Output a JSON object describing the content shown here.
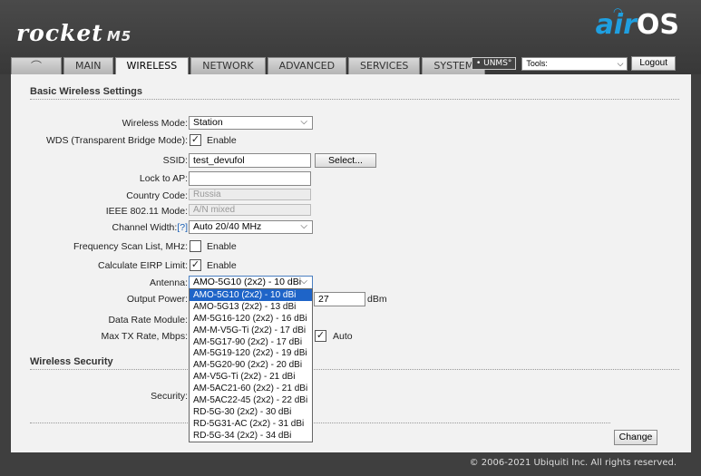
{
  "header": {
    "logo_product": "rocket",
    "logo_model": "M5",
    "logo_airos_air": "air",
    "logo_airos_os": "OS"
  },
  "tabs": [
    {
      "label": "MAIN"
    },
    {
      "label": "WIRELESS",
      "active": true
    },
    {
      "label": "NETWORK"
    },
    {
      "label": "ADVANCED"
    },
    {
      "label": "SERVICES"
    },
    {
      "label": "SYSTEM"
    }
  ],
  "logo_tab_glyph": "⌒",
  "topbar": {
    "unms_label": "• UNMS°",
    "tools_value": "Tools:",
    "logout_label": "Logout"
  },
  "basic": {
    "title": "Basic Wireless Settings",
    "wireless_mode_label": "Wireless Mode:",
    "wireless_mode_value": "Station",
    "wds_label": "WDS (Transparent Bridge Mode):",
    "wds_check": "Enable",
    "ssid_label": "SSID:",
    "ssid_value": "test_devufol",
    "select_button": "Select...",
    "lock_label": "Lock to AP:",
    "lock_value": "",
    "country_label": "Country Code:",
    "country_value": "Russia",
    "ieee_label": "IEEE 802.11 Mode:",
    "ieee_value": "A/N mixed",
    "channel_width_label": "Channel Width:",
    "channel_width_help": "[?]",
    "channel_width_value": "Auto 20/40 MHz",
    "freq_scan_label": "Frequency Scan List, MHz:",
    "freq_scan_check": "Enable",
    "eirp_label": "Calculate EIRP Limit:",
    "eirp_check": "Enable",
    "antenna_label": "Antenna:",
    "antenna_value": "AMO-5G10 (2x2) - 10 dBi",
    "output_power_label": "Output Power:",
    "output_power_value": "27",
    "output_power_unit": "dBm",
    "data_rate_label": "Data Rate Module:",
    "max_tx_label": "Max TX Rate, Mbps:",
    "max_tx_check": "Auto"
  },
  "antenna_options": [
    "AMO-5G10 (2x2) - 10 dBi",
    "AMO-5G13 (2x2) - 13 dBi",
    "AM-5G16-120 (2x2) - 16 dBi",
    "AM-M-V5G-Ti (2x2) - 17 dBi",
    "AM-5G17-90 (2x2) - 17 dBi",
    "AM-5G19-120 (2x2) - 19 dBi",
    "AM-5G20-90 (2x2) - 20 dBi",
    "AM-V5G-Ti (2x2) - 21 dBi",
    "AM-5AC21-60 (2x2) - 21 dBi",
    "AM-5AC22-45 (2x2) - 22 dBi",
    "RD-5G-30 (2x2) - 30 dBi",
    "RD-5G31-AC (2x2) - 31 dBi",
    "RD-5G-34 (2x2) - 34 dBi"
  ],
  "security": {
    "title": "Wireless Security",
    "security_label": "Security:"
  },
  "change_button": "Change",
  "footer": "© 2006-2021 Ubiquiti Inc. All rights reserved."
}
